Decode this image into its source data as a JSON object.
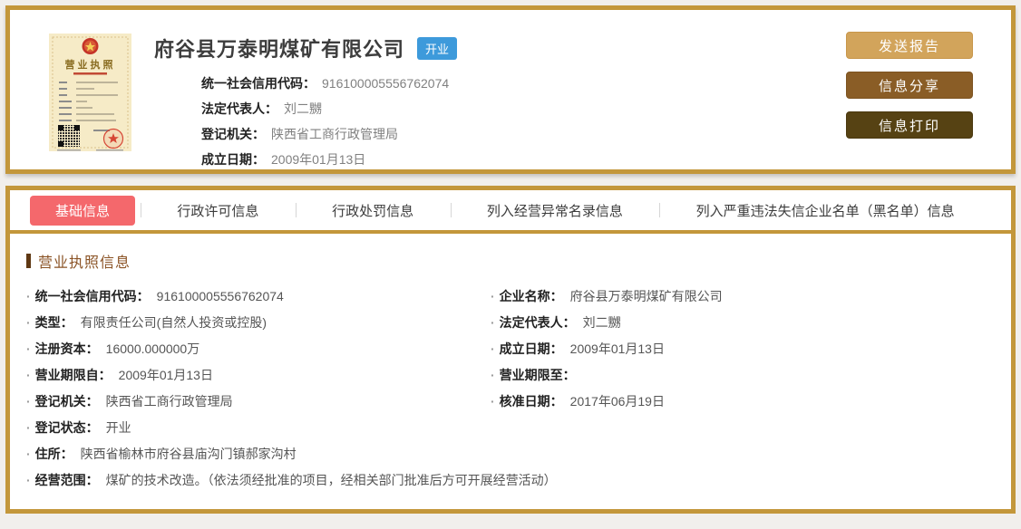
{
  "colors": {
    "panel_border": "#c3973b",
    "active_tab_bg": "#f4686c",
    "status_badge_bg": "#3d9adb",
    "send_button_bg": "#d2a45b",
    "share_button_bg": "#8a5d26",
    "print_button_bg": "#564213",
    "section_title_text": "#8a5224"
  },
  "header": {
    "company_name": "府谷县万泰明煤矿有限公司",
    "status_badge": "开业",
    "license_title": "营业执照",
    "fields": [
      {
        "label": "统一社会信用代码：",
        "value": "916100005556762074"
      },
      {
        "label": "法定代表人：",
        "value": "刘二嬲"
      },
      {
        "label": "登记机关：",
        "value": "陕西省工商行政管理局"
      },
      {
        "label": "成立日期：",
        "value": "2009年01月13日"
      }
    ],
    "buttons": {
      "send": "发送报告",
      "share": "信息分享",
      "print": "信息打印"
    }
  },
  "tabs": {
    "basic": "基础信息",
    "permit": "行政许可信息",
    "penalty": "行政处罚信息",
    "abnormal": "列入经营异常名录信息",
    "blacklist": "列入严重违法失信企业名单（黑名单）信息"
  },
  "content": {
    "section_title": "营业执照信息",
    "rows": [
      {
        "left": {
          "label": "统一社会信用代码：",
          "value": "916100005556762074"
        },
        "right": {
          "label": "企业名称：",
          "value": "府谷县万泰明煤矿有限公司"
        }
      },
      {
        "left": {
          "label": "类型：",
          "value": "有限责任公司(自然人投资或控股)"
        },
        "right": {
          "label": "法定代表人：",
          "value": "刘二嬲"
        }
      },
      {
        "left": {
          "label": "注册资本：",
          "value": "16000.000000万"
        },
        "right": {
          "label": "成立日期：",
          "value": "2009年01月13日"
        }
      },
      {
        "left": {
          "label": "营业期限自：",
          "value": "2009年01月13日"
        },
        "right": {
          "label": "营业期限至：",
          "value": ""
        }
      },
      {
        "left": {
          "label": "登记机关：",
          "value": "陕西省工商行政管理局"
        },
        "right": {
          "label": "核准日期：",
          "value": "2017年06月19日"
        }
      },
      {
        "left": {
          "label": "登记状态：",
          "value": "开业"
        }
      },
      {
        "left": {
          "label": "住所：",
          "value": "陕西省榆林市府谷县庙沟门镇郝家沟村"
        }
      },
      {
        "left": {
          "label": "经营范围：",
          "value": "煤矿的技术改造。（依法须经批准的项目，经相关部门批准后方可开展经营活动）"
        }
      }
    ]
  }
}
